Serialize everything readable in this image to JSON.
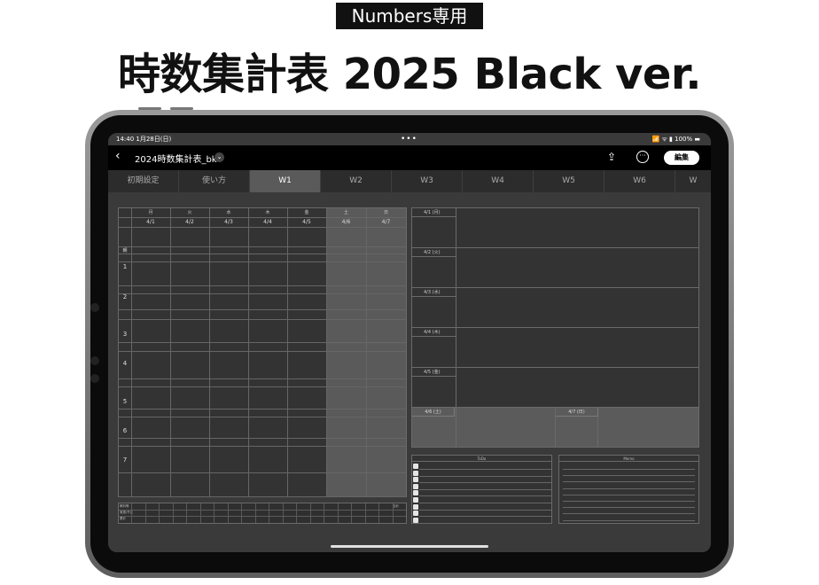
{
  "promo": {
    "badge": "Numbers専用",
    "headline": "時数集計表 2025 Black ver."
  },
  "statusbar": {
    "time_date": "14:40  1月28日(日)",
    "dots": "•••",
    "right": "📶 ᯤ ▮ 100% ▬"
  },
  "navbar": {
    "back": "‹",
    "title": "2024時数集計表_bk",
    "title_chevron": "⌄",
    "share_icon": "share-icon",
    "share_glyph": "⇪",
    "more_glyph": "···",
    "edit_label": "編集"
  },
  "tabs": [
    "初期設定",
    "使い方",
    "W1",
    "W2",
    "W3",
    "W4",
    "W5",
    "W6",
    "W"
  ],
  "active_tab": "W1",
  "schedule": {
    "weekdays": [
      "月",
      "火",
      "水",
      "木",
      "金",
      "土",
      "日"
    ],
    "dates": [
      "4/1",
      "4/2",
      "4/3",
      "4/4",
      "4/5",
      "4/6",
      "4/7"
    ],
    "morning_label": "朝",
    "periods": [
      "1",
      "2",
      "3",
      "4",
      "5",
      "6",
      "7"
    ]
  },
  "summary": {
    "labels": [
      "教科等",
      "実施/予定",
      "累計"
    ],
    "right_label": "合計"
  },
  "daily": {
    "weekday_labels": [
      "4/1 (月)",
      "4/2 (火)",
      "4/3 (水)",
      "4/4 (木)",
      "4/5 (金)"
    ],
    "weekend_labels": [
      "4/6 (土)",
      "4/7 (日)"
    ]
  },
  "todo": {
    "title": "ToDo"
  },
  "memo": {
    "title": "Memo"
  },
  "colors": {
    "screen_bg": "#3a3a3a",
    "active_tab": "#5a5a5a",
    "weekend_fill": "#5a5a5a"
  }
}
